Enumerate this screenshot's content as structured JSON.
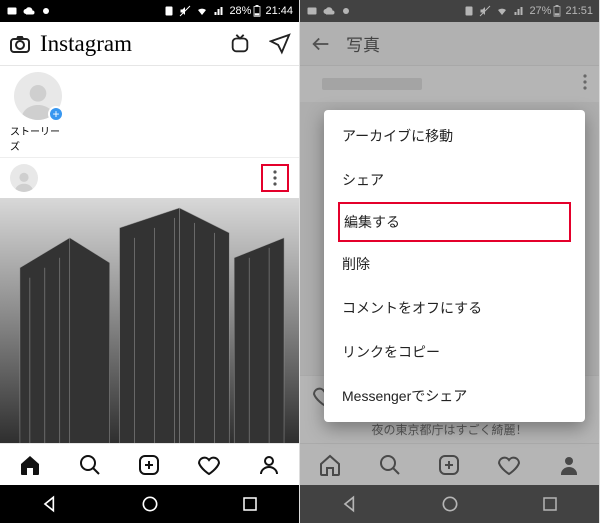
{
  "left": {
    "status": {
      "battery": "28%",
      "time": "21:44"
    },
    "brand": "Instagram",
    "story_label": "ストーリーズ"
  },
  "right": {
    "status": {
      "battery": "27%",
      "time": "21:51"
    },
    "page_title": "写真",
    "caption": "夜の東京都庁はすごく綺麗！",
    "menu": {
      "archive": "アーカイブに移動",
      "share": "シェア",
      "edit": "編集する",
      "delete": "削除",
      "comments_off": "コメントをオフにする",
      "copy_link": "リンクをコピー",
      "messenger_share": "Messengerでシェア"
    }
  }
}
